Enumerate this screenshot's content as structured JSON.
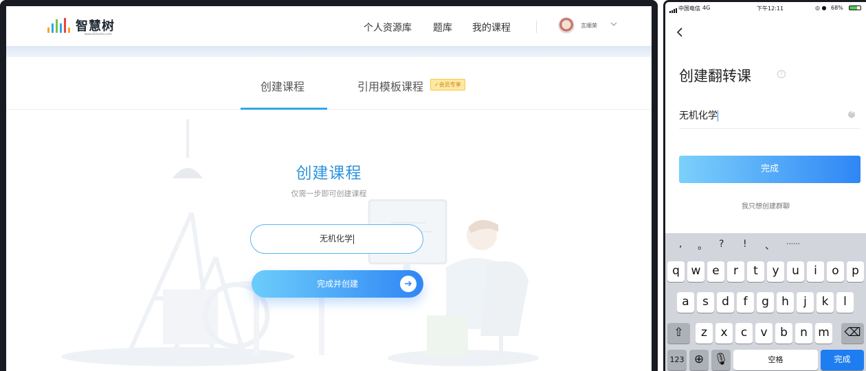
{
  "desktop": {
    "logo": {
      "text": "智慧树",
      "url": "www.zhihuishu.com",
      "bar_colors": [
        "#f6a623",
        "#2fa6e8",
        "#7bc043",
        "#2fa6e8",
        "#e8453c",
        "#f6a623"
      ]
    },
    "nav": {
      "items": [
        "个人资源库",
        "题库",
        "我的课程"
      ]
    },
    "user": {
      "name": "言顺荣"
    },
    "tabs": {
      "create": "创建课程",
      "template": "引用模板课程",
      "vip_badge": "会员专享"
    },
    "panel": {
      "title": "创建课程",
      "subtitle": "仅需一步即可创建课程",
      "input_value": "无机化学",
      "submit_label": "完成并创建"
    },
    "colors": {
      "accent": "#2fa6e8",
      "button_start": "#6ccdfa",
      "button_end": "#2f86f5"
    }
  },
  "phone": {
    "status": {
      "carrier": "中国电信",
      "network": "4G",
      "time": "下午12:11",
      "battery": "68%"
    },
    "title": "创建翻转课",
    "input_value": "无机化学",
    "done_label": "完成",
    "group_link": "我只想创建群聊",
    "keyboard": {
      "punctuation": [
        ",",
        "。",
        "?",
        "!",
        "、",
        "……"
      ],
      "row1": [
        "q",
        "w",
        "e",
        "r",
        "t",
        "y",
        "u",
        "i",
        "o",
        "p"
      ],
      "row2": [
        "a",
        "s",
        "d",
        "f",
        "g",
        "h",
        "j",
        "k",
        "l"
      ],
      "row3": [
        "z",
        "x",
        "c",
        "v",
        "b",
        "n",
        "m"
      ],
      "numbers_key": "123",
      "space_key": "空格",
      "done_key": "完成"
    }
  }
}
